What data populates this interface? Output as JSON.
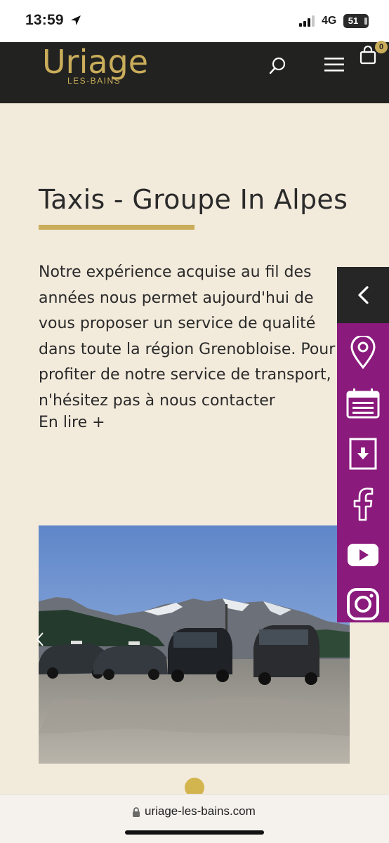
{
  "status_bar": {
    "time": "13:59",
    "network": "4G",
    "battery": "51"
  },
  "header": {
    "logo_main": "Uriage",
    "logo_sub": "LES-BAINS",
    "cart_count": "0",
    "icons": [
      "search-icon",
      "menu-icon",
      "cart-icon"
    ]
  },
  "main": {
    "title": "Taxis - Groupe In Alpes",
    "intro_lines": [
      "Notre expérience acquise au fil des",
      "années nous permet aujourd'hui de",
      "vous proposer un service de qualité",
      "dans toute la région Grenobloise. Pour",
      "profiter de notre service de transport,",
      "n'hésitez pas à nous contacter"
    ],
    "read_more": "En lire +"
  },
  "side_panel": {
    "items": [
      "chevron-left-icon",
      "location-pin-icon",
      "calendar-icon",
      "download-icon",
      "facebook-icon",
      "youtube-icon",
      "instagram-icon"
    ]
  },
  "browser": {
    "url": "uriage-les-bains.com"
  },
  "colors": {
    "background": "#f2eadb",
    "header": "#222220",
    "gold": "#c9ad5a",
    "purple": "#8a1a7c"
  }
}
